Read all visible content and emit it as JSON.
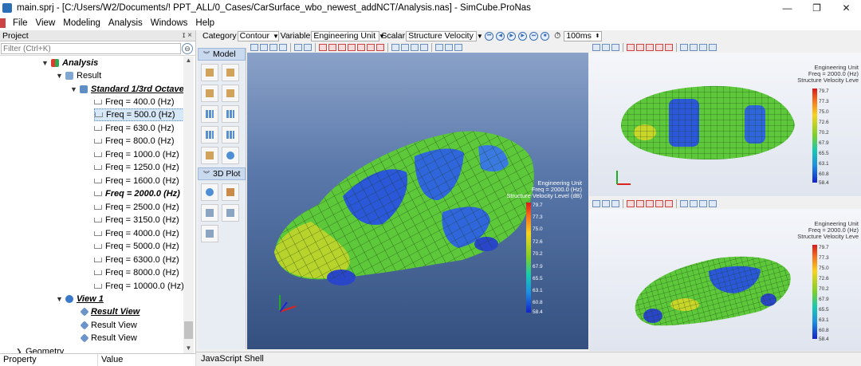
{
  "window": {
    "title": "main.sprj - [C:/Users/W2/Documents/! PPT_ALL/0_Cases/CarSurface_wbo_newest_addNCT/Analysis.nas] - SimCube.ProNas",
    "controls": [
      "—",
      "❐",
      "✕"
    ]
  },
  "menu": [
    "File",
    "View",
    "Modeling",
    "Analysis",
    "Windows",
    "Help"
  ],
  "project_panel": {
    "header": "Project",
    "header_controls": "ɪ ×",
    "filter_placeholder": "Filter (Ctrl+K)",
    "tree": [
      {
        "label": "Analysis",
        "style": "bold-italic",
        "icon": "analysis-icon"
      },
      {
        "label": "Result",
        "style": "normal",
        "icon": "result-icon"
      },
      {
        "label": "Standard 1/3rd Octave",
        "style": "bold-italic-underline",
        "icon": "octave-icon"
      },
      {
        "label": "Freq = 400.0 (Hz)"
      },
      {
        "label": "Freq = 500.0 (Hz)",
        "selected": true
      },
      {
        "label": "Freq = 630.0 (Hz)"
      },
      {
        "label": "Freq = 800.0 (Hz)"
      },
      {
        "label": "Freq = 1000.0 (Hz)"
      },
      {
        "label": "Freq = 1250.0 (Hz)"
      },
      {
        "label": "Freq = 1600.0 (Hz)"
      },
      {
        "label": "Freq = 2000.0 (Hz)",
        "style": "bold-italic"
      },
      {
        "label": "Freq = 2500.0 (Hz)"
      },
      {
        "label": "Freq = 3150.0 (Hz)"
      },
      {
        "label": "Freq = 4000.0 (Hz)"
      },
      {
        "label": "Freq = 5000.0 (Hz)"
      },
      {
        "label": "Freq = 6300.0 (Hz)"
      },
      {
        "label": "Freq = 8000.0 (Hz)"
      },
      {
        "label": "Freq = 10000.0 (Hz)"
      },
      {
        "label": "View 1",
        "style": "bold-italic-underline",
        "icon": "view-icon"
      },
      {
        "label": "Result View",
        "style": "bold-italic-underline",
        "icon": "cube-icon"
      },
      {
        "label": "Result View",
        "icon": "cube-icon"
      },
      {
        "label": "Result View",
        "icon": "cube-icon"
      },
      {
        "label": "Geometry"
      }
    ]
  },
  "property_bar": {
    "col1": "Property",
    "col2": "Value"
  },
  "toolbar": {
    "category_label": "Category",
    "category_value": "Contour",
    "variable_label": "Variable",
    "variable_value": "Engineering Unit",
    "scalar_label": "Scalar",
    "scalar_value": "Structure Velocity",
    "interval_icon": "timer-icon",
    "interval_value": "100ms"
  },
  "model_sidebar": {
    "section1": "Model",
    "section2": "3D Plot"
  },
  "legend": {
    "line1": "Engineering Unit",
    "line2": "Freq = 2000.0 (Hz)",
    "line3": "Structure Velocity Level (dB)",
    "line3_side": "Structure Velocity Leve",
    "ticks": [
      "79.7",
      "77.3",
      "75.0",
      "72.6",
      "70.2",
      "67.9",
      "65.5",
      "63.1",
      "60.8",
      "58.4"
    ]
  },
  "colors": {
    "main_bg_top": "#8aa2c8",
    "main_bg_bottom": "#33507f",
    "mesh_green": "#4cc23a",
    "mesh_blue": "#2c55d8",
    "mesh_yellow": "#d8d22a"
  },
  "status": {
    "shell": "JavaScript Shell"
  }
}
